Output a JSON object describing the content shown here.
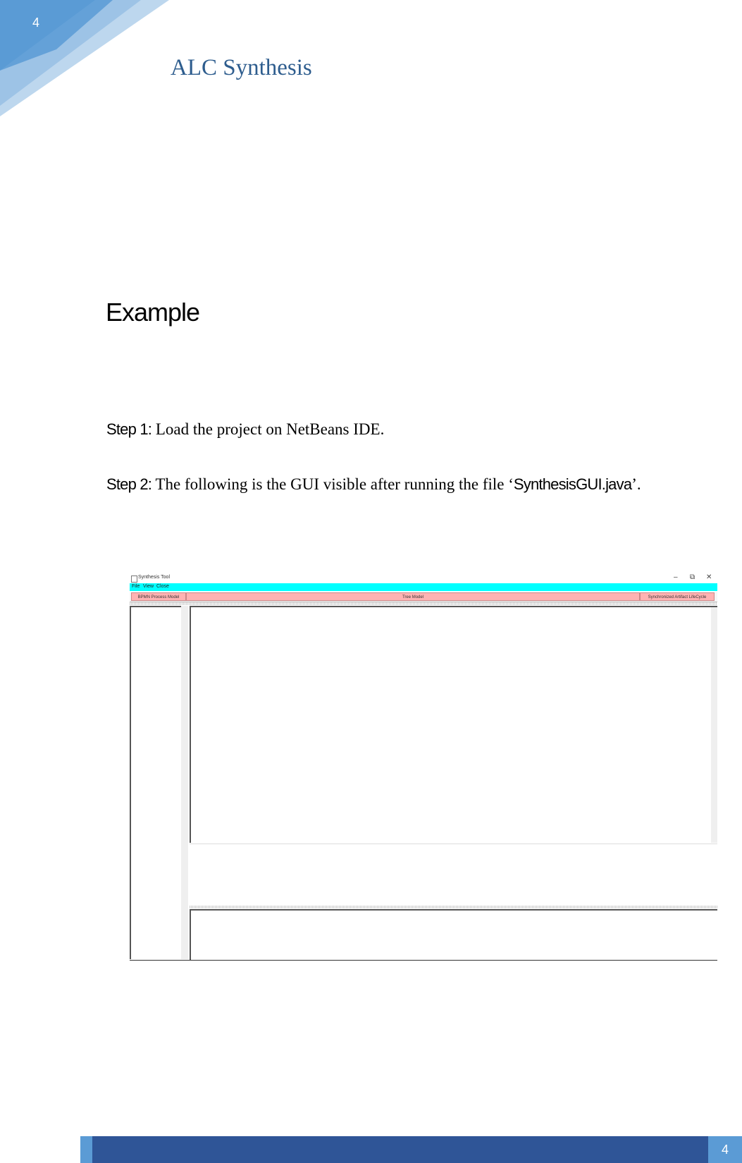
{
  "header": {
    "page_number": "4",
    "title": "ALC Synthesis"
  },
  "content": {
    "heading": "Example",
    "step1": {
      "label": "Step 1:",
      "text": " Load the project on NetBeans IDE."
    },
    "step2": {
      "label": "Step 2:",
      "text": " The following is the GUI visible after running the file ‘",
      "file": "SynthesisGUI.java",
      "end": "’."
    }
  },
  "gui_screenshot": {
    "window_title": "Synthesis Tool",
    "window_controls": {
      "minimize": "–",
      "restore": "⧉",
      "close": "✕"
    },
    "menu": [
      "File",
      "View",
      "Close"
    ],
    "tabs": [
      "BPMN Process Model",
      "Tree Model",
      "Synchronized Artifact LifeCycle"
    ],
    "colors": {
      "menubar": "#00ffff",
      "tabs": "#ffb3b3"
    }
  },
  "footer": {
    "page_number": "4",
    "colors": {
      "bar": "#2f5597",
      "accent": "#5b9bd5"
    }
  }
}
